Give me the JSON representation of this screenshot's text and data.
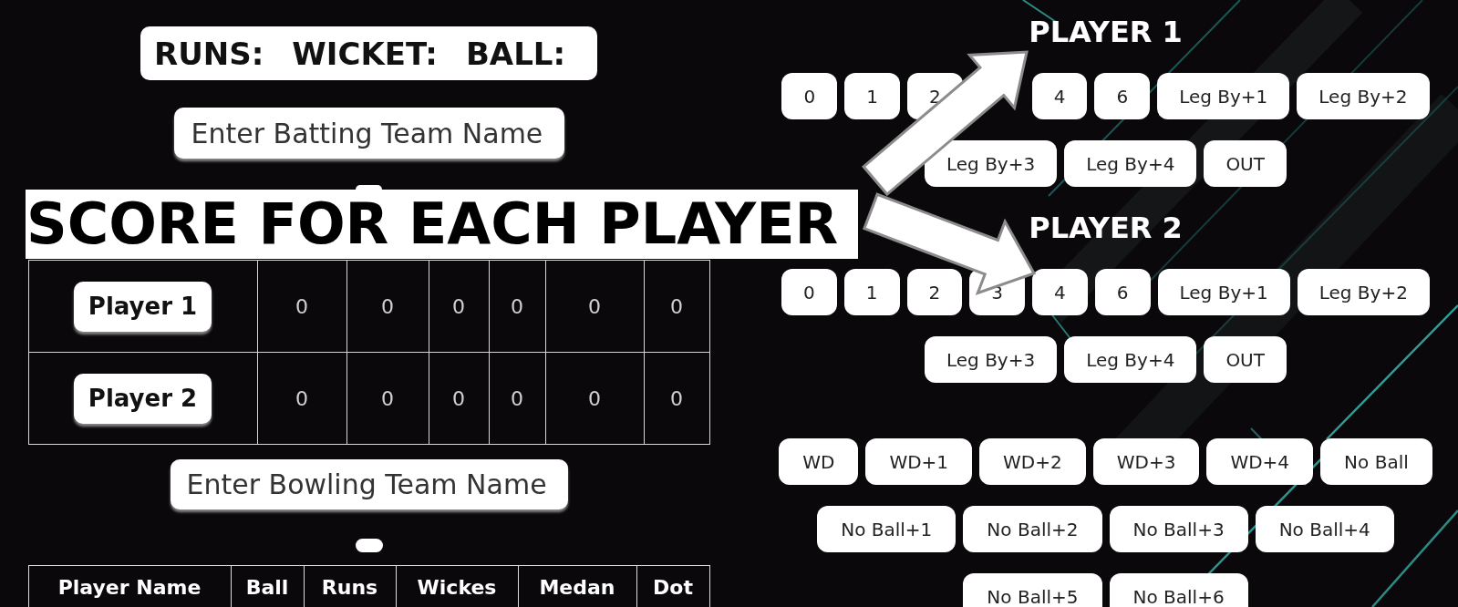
{
  "scoreboard": {
    "labels": [
      "RUNS:",
      "WICKET:",
      "BALL:"
    ]
  },
  "batting_team": {
    "placeholder": "Enter Batting Team Name"
  },
  "batting_table": {
    "rows": [
      {
        "player": "Player 1",
        "cells": [
          "0",
          "0",
          "0",
          "0",
          "0",
          "0"
        ]
      },
      {
        "player": "Player 2",
        "cells": [
          "0",
          "0",
          "0",
          "0",
          "0",
          "0"
        ]
      }
    ]
  },
  "bowling_team": {
    "placeholder": "Enter Bowling Team Name"
  },
  "bowling_table": {
    "columns": [
      "Player Name",
      "Ball",
      "Runs",
      "Wickes",
      "Medan",
      "Dot"
    ]
  },
  "caption": "SCORE FOR EACH PLAYER",
  "players": [
    {
      "title": "PLAYER 1",
      "buttons": [
        {
          "kind": "button",
          "label": "0"
        },
        {
          "kind": "button",
          "label": "1"
        },
        {
          "kind": "button",
          "label": "2"
        },
        {
          "kind": "covered"
        },
        {
          "kind": "button",
          "label": "4"
        },
        {
          "kind": "button",
          "label": "6"
        },
        {
          "kind": "button",
          "label": "Leg By+1"
        },
        {
          "kind": "button",
          "label": "Leg By+2"
        },
        {
          "kind": "button",
          "label": "Leg By+3"
        },
        {
          "kind": "button",
          "label": "Leg By+4"
        },
        {
          "kind": "button",
          "label": "OUT"
        }
      ]
    },
    {
      "title": "PLAYER 2",
      "buttons": [
        {
          "kind": "button",
          "label": "0"
        },
        {
          "kind": "button",
          "label": "1"
        },
        {
          "kind": "button",
          "label": "2"
        },
        {
          "kind": "button",
          "label": "3"
        },
        {
          "kind": "button",
          "label": "4"
        },
        {
          "kind": "button",
          "label": "6"
        },
        {
          "kind": "button",
          "label": "Leg By+1"
        },
        {
          "kind": "button",
          "label": "Leg By+2"
        },
        {
          "kind": "button",
          "label": "Leg By+3"
        },
        {
          "kind": "button",
          "label": "Leg By+4"
        },
        {
          "kind": "button",
          "label": "OUT"
        }
      ]
    }
  ],
  "extras": {
    "buttons": [
      "WD",
      "WD+1",
      "WD+2",
      "WD+3",
      "WD+4",
      "No Ball",
      "No Ball+1",
      "No Ball+2",
      "No Ball+3",
      "No Ball+4",
      "No Ball+5",
      "No Ball+6"
    ]
  }
}
